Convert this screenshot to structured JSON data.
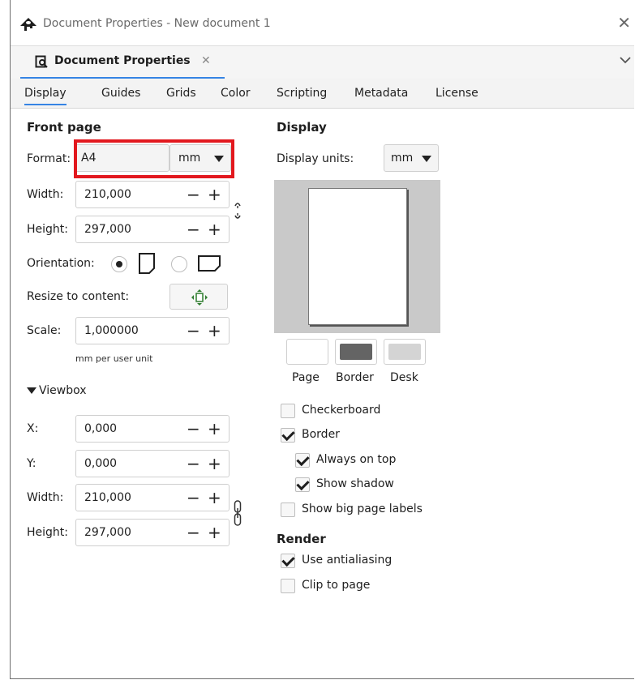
{
  "window": {
    "title": "Document Properties - New document 1"
  },
  "dock": {
    "tab_label": "Document Properties",
    "tab_close": "✕"
  },
  "tabs": [
    "Display",
    "Guides",
    "Grids",
    "Color",
    "Scripting",
    "Metadata",
    "License"
  ],
  "front_page": {
    "heading": "Front page",
    "format_label": "Format:",
    "format_value": "A4",
    "format_unit": "mm",
    "width_label": "Width:",
    "width_value": "210,000",
    "height_label": "Height:",
    "height_value": "297,000",
    "orientation_label": "Orientation:",
    "orientation_selected": "portrait",
    "resize_label": "Resize to content:",
    "scale_label": "Scale:",
    "scale_value": "1,000000",
    "scale_hint": "mm  per user unit"
  },
  "viewbox": {
    "heading": "Viewbox",
    "x_label": "X:",
    "x_value": "0,000",
    "y_label": "Y:",
    "y_value": "0,000",
    "width_label": "Width:",
    "width_value": "210,000",
    "height_label": "Height:",
    "height_value": "297,000"
  },
  "display": {
    "heading": "Display",
    "units_label": "Display units:",
    "units_value": "mm",
    "swatch_labels": {
      "page": "Page",
      "border": "Border",
      "desk": "Desk"
    },
    "swatch_colors": {
      "page": "#ffffff",
      "border": "#646464",
      "desk": "#d4d4d4"
    },
    "checkerboard": {
      "label": "Checkerboard",
      "checked": false
    },
    "border": {
      "label": "Border",
      "checked": true
    },
    "always_on_top": {
      "label": "Always on top",
      "checked": true
    },
    "show_shadow": {
      "label": "Show shadow",
      "checked": true
    },
    "big_labels": {
      "label": "Show big page labels",
      "checked": false
    }
  },
  "render": {
    "heading": "Render",
    "antialiasing": {
      "label": "Use antialiasing",
      "checked": true
    },
    "clip": {
      "label": "Clip to page",
      "checked": false
    }
  },
  "colors": {
    "accent": "#3584e4",
    "highlight": "#e2181e"
  }
}
